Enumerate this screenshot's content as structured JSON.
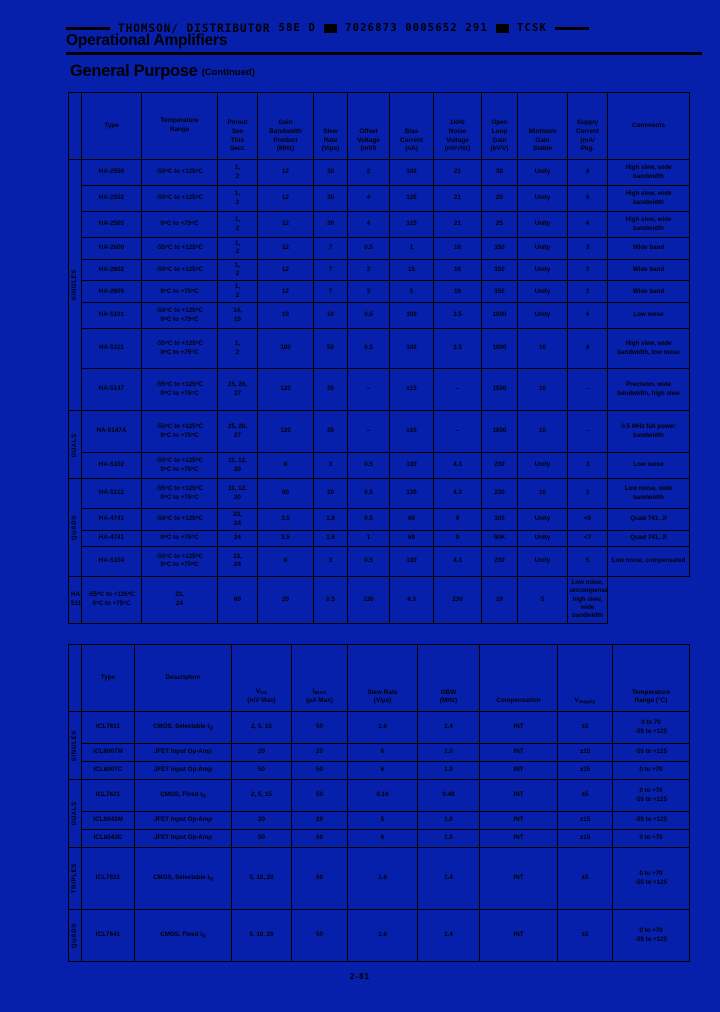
{
  "header": {
    "rule_left": "rule",
    "distributor": "THOMSON/ DISTRIBUTOR",
    "barcode_text_1": "58E D",
    "barcode_text_2": "7026873 0005652 291",
    "barcode_text_3": "TCSK",
    "title": "Operational Amplifiers",
    "section_title": "General Purpose",
    "section_continued": "(Continued)"
  },
  "footer": {
    "page_number": "2-81"
  },
  "table1": {
    "columns": [
      "Type",
      "Temperature Range",
      "Pinout See This Sect.",
      "Gain Bandwidth Product (MHz)",
      "Slew Rate (V/µs)",
      "Offset Voltage (mV0",
      "Bias Current (nA)",
      "1kHz Noise Voltage (nV/√Hz)",
      "Open Loop Gain (kV/V)",
      "Minimum Gain Stable",
      "Supply Current (mA/ Pkg.",
      "Comments"
    ],
    "col_head": {
      "type": "Type",
      "temp_1": "Temperature",
      "temp_2": "Range",
      "pinout_1": "Pinout",
      "pinout_2": "See",
      "pinout_3": "This",
      "pinout_4": "Sect.",
      "gbw_1": "Gain",
      "gbw_2": "Bandwidth",
      "gbw_3": "Product",
      "gbw_4": "(MHz)",
      "slew_1": "Slew",
      "slew_2": "Rate",
      "slew_3": "(V/µs)",
      "offset_1": "Offset",
      "offset_2": "Voltage",
      "offset_3": "(mV0",
      "bias_1": "Bias",
      "bias_2": "Current",
      "bias_3": "(nA)",
      "noise_1": "1kHz",
      "noise_2": "Noise",
      "noise_3": "Voltage",
      "noise_4": "(nV/√Hz)",
      "olg_1": "Open",
      "olg_2": "Loop",
      "olg_3": "Gain",
      "olg_4": "(kV/V)",
      "mgs_1": "Minimum",
      "mgs_2": "Gain",
      "mgs_3": "Stable",
      "supply_1": "Supply",
      "supply_2": "Current",
      "supply_3": "(mA/",
      "supply_4": "Pkg.",
      "comments": "Comments"
    },
    "families": [
      {
        "label": "SINGLES",
        "rows": 9
      },
      {
        "label": "DUALS",
        "rows": 2
      },
      {
        "label": "QUADS",
        "rows": 4
      }
    ],
    "rows": [
      {
        "type": "HA-2500",
        "temp": "-55°C to +125°C",
        "pinout": "1, 2",
        "gbw": "12",
        "slew": "30",
        "offset": "2",
        "bias": "100",
        "noise": "21",
        "olg": "30",
        "mgs": "Unity",
        "supply": "4",
        "comments": "High slew, wide bandwidth"
      },
      {
        "type": "HA-2502",
        "temp": "-55°C to +125°C",
        "pinout": "1, 2",
        "gbw": "12",
        "slew": "30",
        "offset": "4",
        "bias": "125",
        "noise": "21",
        "olg": "25",
        "mgs": "Unity",
        "supply": "4",
        "comments": "High slew, wide bandwidth"
      },
      {
        "type": "HA-2505",
        "temp": "0°C to +75°C",
        "pinout": "1, 2",
        "gbw": "12",
        "slew": "30",
        "offset": "4",
        "bias": "125",
        "noise": "21",
        "olg": "25",
        "mgs": "Unity",
        "supply": "4",
        "comments": "High slew, wide bandwidth"
      },
      {
        "type": "HA-2600",
        "temp": "-55°C to +125°C",
        "pinout": "1, 2",
        "gbw": "12",
        "slew": "7",
        "offset": "0.5",
        "bias": "1",
        "noise": "16",
        "olg": "150",
        "mgs": "Unity",
        "supply": "3",
        "comments": "Wide band"
      },
      {
        "type": "HA-2602",
        "temp": "-55°C to +125°C",
        "pinout": "1, 2",
        "gbw": "12",
        "slew": "7",
        "offset": "3",
        "bias": "15",
        "noise": "16",
        "olg": "150",
        "mgs": "Unity",
        "supply": "3",
        "comments": "Wide band"
      },
      {
        "type": "HA-2605",
        "temp": "0°C to +75°C",
        "pinout": "1, 2",
        "gbw": "12",
        "slew": "7",
        "offset": "3",
        "bias": "5",
        "noise": "16",
        "olg": "150",
        "mgs": "Unity",
        "supply": "3",
        "comments": "Wide band"
      },
      {
        "type": "HA-5101",
        "temp": "-55°C to +125°C\n0°C to +75°C",
        "pinout": "14, 15",
        "gbw": "10",
        "slew": "10",
        "offset": "0.5",
        "bias": "100",
        "noise": "3.5",
        "olg": "1000",
        "mgs": "Unity",
        "supply": "4",
        "comments": "Low noise"
      },
      {
        "type": "HA-5111",
        "temp": "-55°C to +125°C\n0°C to +75°C",
        "pinout": "1, 2",
        "gbw": "100",
        "slew": "50",
        "offset": "0.5",
        "bias": "100",
        "noise": "3.5",
        "olg": "1000",
        "mgs": "10",
        "supply": "4",
        "comments": "High slew, wide bandwidth, low noise"
      },
      {
        "type": "HA-5147",
        "temp": "-55°C to +125°C\n0°C to +75°C",
        "pinout": "25, 26, 27",
        "gbw": "120",
        "slew": "35",
        "offset": "–",
        "bias": "±15",
        "noise": "–",
        "olg": "1500",
        "mgs": "10",
        "supply": "–",
        "comments": "Precision, wide bandwidth, high slew"
      },
      {
        "type": "HA-5147A",
        "temp": "-55°C to +125°C\n0°C to +75°C",
        "pinout": "25, 26, 27",
        "gbw": "120",
        "slew": "35",
        "offset": "–",
        "bias": "±10",
        "noise": "–",
        "olg": "1800",
        "mgs": "10",
        "supply": "–",
        "comments": "0.5 MHz full power bandwidth"
      },
      {
        "type": "HA-5102",
        "temp": "-55°C to +125°C\n0°C to +75°C",
        "pinout": "11, 12, 30",
        "gbw": "8",
        "slew": "3",
        "offset": "0.5",
        "bias": "130",
        "noise": "4.3",
        "olg": "230",
        "mgs": "Unity",
        "supply": "3",
        "comments": "Low noise"
      },
      {
        "type": "HA-5112",
        "temp": "-55°C to +125°C\n0°C to +75°C",
        "pinout": "11, 12, 30",
        "gbw": "60",
        "slew": "20",
        "offset": "0.5",
        "bias": "130",
        "noise": "4.3",
        "olg": "230",
        "mgs": "10",
        "supply": "3",
        "comments": "Low noise, wide bandwidth"
      },
      {
        "type": "HA-4741",
        "temp": "-55°C to +125°C",
        "pinout": "23, 24",
        "gbw": "3.5",
        "slew": "1.6",
        "offset": "0.5",
        "bias": "60",
        "noise": "9",
        "olg": "100",
        "mgs": "Unity",
        "supply": "<6",
        "comments": "Quad 741, JI"
      },
      {
        "type": "HA-4741",
        "temp": "0°C to +75°C",
        "pinout": "24",
        "gbw": "3.5",
        "slew": "1.6",
        "offset": "1",
        "bias": "60",
        "noise": "9",
        "olg": "50K",
        "mgs": "Unity",
        "supply": "<7",
        "comments": "Quad 741, JI"
      },
      {
        "type": "HA-5104",
        "temp": "-55°C to +125°C\n0°C to +75°C",
        "pinout": "23, 24",
        "gbw": "8",
        "slew": "3",
        "offset": "0.5",
        "bias": "130",
        "noise": "4.3",
        "olg": "230",
        "mgs": "Unity",
        "supply": "5",
        "comments": "Low noise, compensated"
      },
      {
        "type": "HA-5114",
        "temp": "-55°C to +125°C\n0°C to +75°C",
        "pinout": "23, 24",
        "gbw": "60",
        "slew": "20",
        "offset": "0.5",
        "bias": "130",
        "noise": "4.3",
        "olg": "230",
        "mgs": "10",
        "supply": "5",
        "comments": "Low noise, uncompensated, high slew, wide bandwidth"
      }
    ]
  },
  "table2": {
    "col_head": {
      "type": "Type",
      "desc": "Description",
      "vos_1": "V",
      "vos_sub": "OS",
      "vos_2": "(mV Max)",
      "ibias_1": "I",
      "ibias_sub": "BIAS",
      "ibias_2": "(pA Max)",
      "slew_1": "Slew Rate",
      "slew_2": "(V/µs)",
      "gbw_1": "GBW",
      "gbw_2": "(MHz)",
      "comp": "Compensation",
      "vsup_1": "V",
      "vsup_sub": "Supply",
      "temp_1": "Temperature",
      "temp_2": "Range (°C)"
    },
    "families": [
      {
        "label": "SINGLES",
        "rows": 3
      },
      {
        "label": "DUALS",
        "rows": 3
      },
      {
        "label": "TRIPLES",
        "rows": 1
      },
      {
        "label": "QUADS",
        "rows": 1
      }
    ],
    "rows": [
      {
        "type": "ICL7611",
        "desc": "CMOS, Selectable I_Q",
        "vos": "2, 5, 15",
        "ibias": "50",
        "slew": "1.6",
        "gbw": "1.4",
        "comp": "INT",
        "vsupply": "±5",
        "temp": "0 to 70\n-55 to +125"
      },
      {
        "type": "ICL8007M",
        "desc": "JFET Input Op-Amp",
        "vos": "20",
        "ibias": "20",
        "slew": "6",
        "gbw": "1.0",
        "comp": "INT",
        "vsupply": "±15",
        "temp": "-55 to +125"
      },
      {
        "type": "ICL8007C",
        "desc": "JFET Input Op-Amp",
        "vos": "50",
        "ibias": "50",
        "slew": "6",
        "gbw": "1.0",
        "comp": "INT",
        "vsupply": "±15",
        "temp": "0 to +70"
      },
      {
        "type": "ICL7621",
        "desc": "CMOS, Fixed I_Q",
        "vos": "2, 5, 15",
        "ibias": "50",
        "slew": "0.16",
        "gbw": "0.48",
        "comp": "INT",
        "vsupply": "±5",
        "temp": "0 to +70\n-55 to +125"
      },
      {
        "type": "ICL8043M",
        "desc": "JFET Input Op-Amp",
        "vos": "20",
        "ibias": "20",
        "slew": "5",
        "gbw": "1.0",
        "comp": "INT",
        "vsupply": "±15",
        "temp": "-55 to +125"
      },
      {
        "type": "ICL8043C",
        "desc": "JFET Input Op-Amp",
        "vos": "50",
        "ibias": "50",
        "slew": "6",
        "gbw": "1.0",
        "comp": "INT",
        "vsupply": "±15",
        "temp": "0 to +70"
      },
      {
        "type": "ICL7631",
        "desc": "CMOS, Selectable I_Q",
        "vos": "5, 10, 20",
        "ibias": "50",
        "slew": "1.6",
        "gbw": "1.4",
        "comp": "INT",
        "vsupply": "±5",
        "temp": "0 to +70\n-55 to +125"
      },
      {
        "type": "ICL7641",
        "desc": "CMOS, Fixed I_Q",
        "vos": "5, 10, 20",
        "ibias": "50",
        "slew": "1.6",
        "gbw": "1.4",
        "comp": "INT",
        "vsupply": "±5",
        "temp": "0 to +70\n-55 to +125"
      }
    ]
  },
  "colors": {
    "page_background": "#0720ac",
    "ink": "#000000"
  }
}
